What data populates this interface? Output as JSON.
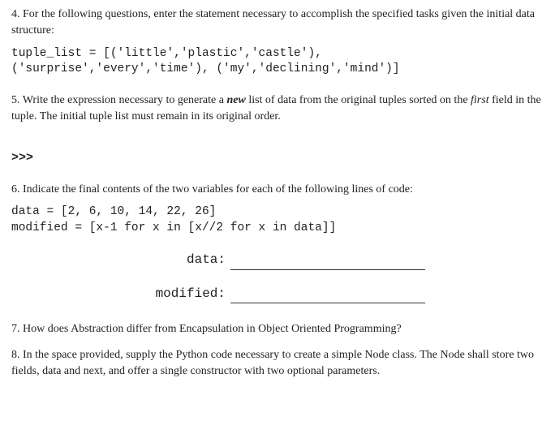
{
  "q4": {
    "text": "4. For the following questions, enter the statement necessary to accomplish the specified tasks given the initial data structure:",
    "code": "tuple_list = [('little','plastic','castle'),\n('surprise','every','time'), ('my','declining','mind')]"
  },
  "q5": {
    "pre": "5. Write the expression necessary to generate a ",
    "new": "new",
    "mid": " list of data from the original tuples sorted on the ",
    "first": "first",
    "post": " field in the tuple. The initial tuple list must remain in its original order."
  },
  "prompt": ">>>",
  "q6": {
    "text": "6. Indicate the final contents of the two variables for each of the following lines of code:",
    "code": "data = [2, 6, 10, 14, 22, 26]\nmodified = [x-1 for x in [x//2 for x in data]]",
    "blanks": {
      "data_label": "data:",
      "modified_label": "modified:"
    }
  },
  "q7": {
    "text": "7. How does Abstraction differ from Encapsulation in Object Oriented Programming?"
  },
  "q8": {
    "text": "8. In the space provided, supply the Python code necessary to create a simple Node class. The Node shall store two fields, data and next, and offer a single constructor with two optional parameters."
  }
}
